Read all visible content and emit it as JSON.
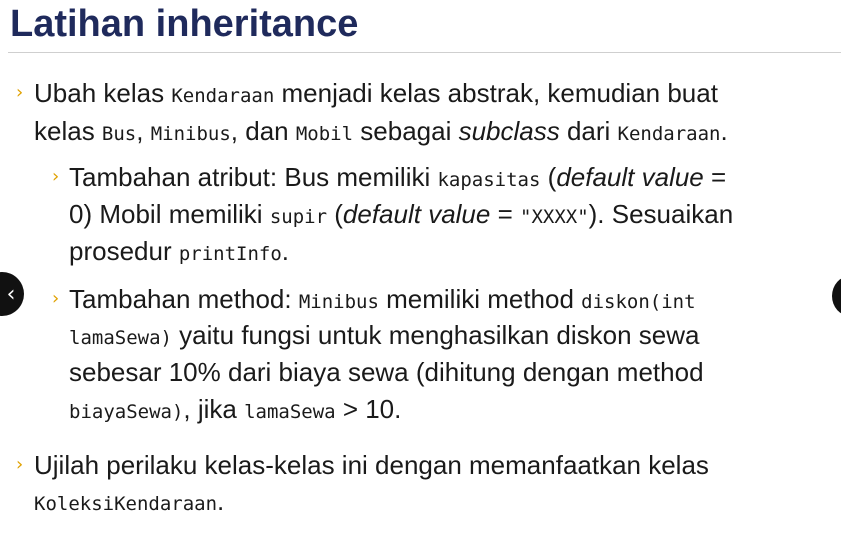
{
  "title": "Latihan inheritance",
  "nav": {
    "prev_label": "‹"
  },
  "bullets": {
    "b1": {
      "t1": "Ubah kelas ",
      "c1": "Kendaraan",
      "t2": " menjadi kelas abstrak, kemudian buat",
      "t3": "kelas ",
      "c2": "Bus",
      "t4": ", ",
      "c3": "Minibus",
      "t5": ", dan ",
      "c4": "Mobil",
      "t6": " sebagai ",
      "em1": "subclass",
      "t7": " dari ",
      "c5": "Kendaraan",
      "t8": "."
    },
    "b2": {
      "t1": "Tambahan atribut: Bus memiliki ",
      "c1": "kapasitas",
      "t2": " (",
      "em1": "default value",
      "t3": " =",
      "t4": "0) Mobil memiliki ",
      "c2": "supir",
      "t5": " (",
      "em2": "default value",
      "t6": " = ",
      "c3": "\"XXXX\"",
      "t7": "). Sesuaikan",
      "t8": "prosedur ",
      "c4": "printInfo",
      "t9": "."
    },
    "b3": {
      "t1": "Tambahan method: ",
      "c1": "Minibus",
      "t2": " memiliki method ",
      "c2": "diskon(int",
      "c3": "lamaSewa)",
      "t3": " yaitu fungsi untuk menghasilkan diskon sewa",
      "t4": "sebesar 10% dari biaya sewa (dihitung dengan method",
      "c4": "biayaSewa)",
      "t5": ", jika ",
      "c5": "lamaSewa",
      "t6": " > 10."
    },
    "b4": {
      "t1": "Ujilah perilaku kelas-kelas ini dengan memanfaatkan kelas",
      "c1": "KoleksiKendaraan",
      "t2": "."
    }
  },
  "marker": "›",
  "colors": {
    "title": "#1f2a5c",
    "marker": "#e0a100",
    "rule": "#cfcfcf"
  }
}
